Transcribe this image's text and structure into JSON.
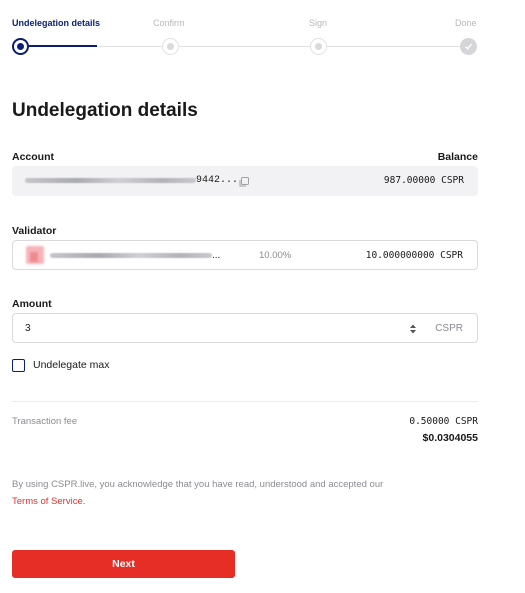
{
  "stepper": {
    "steps": [
      {
        "label": "Undelegation details",
        "state": "current"
      },
      {
        "label": "Confirm",
        "state": "pending"
      },
      {
        "label": "Sign",
        "state": "pending"
      },
      {
        "label": "Done",
        "state": "done"
      }
    ]
  },
  "page": {
    "title": "Undelegation details"
  },
  "account": {
    "label": "Account",
    "balance_label": "Balance",
    "address_suffix": "9442...",
    "balance_value": "987.00000 CSPR",
    "copy_icon": "copy-icon"
  },
  "validator": {
    "label": "Validator",
    "name_ellipsis": "...",
    "fee": "10.00%",
    "stake": "10.000000000 CSPR"
  },
  "amount": {
    "label": "Amount",
    "value": "3",
    "unit": "CSPR"
  },
  "undelegate_max": {
    "label": "Undelegate max",
    "checked": false
  },
  "fee": {
    "label": "Transaction fee",
    "cspr": "0.50000 CSPR",
    "usd": "$0.0304055"
  },
  "legal": {
    "text": "By using CSPR.live, you acknowledge that you have read, understood and accepted our",
    "link": "Terms of Service."
  },
  "actions": {
    "next_label": "Next"
  },
  "colors": {
    "accent": "#0b1e73",
    "brand_red": "#e62d26"
  }
}
